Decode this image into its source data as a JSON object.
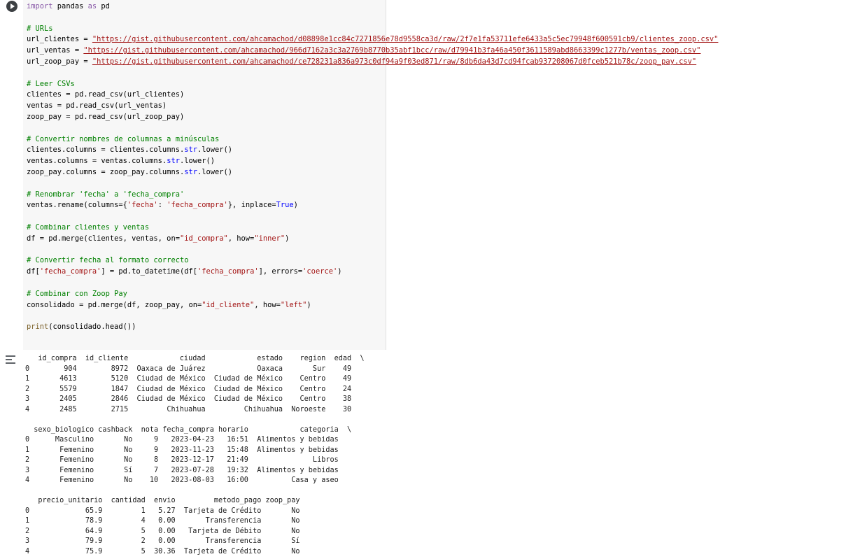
{
  "cell": {
    "code_lines": [
      [
        {
          "t": "import",
          "c": "kw"
        },
        {
          "t": " pandas "
        },
        {
          "t": "as",
          "c": "kw"
        },
        {
          "t": " pd"
        }
      ],
      [],
      [
        {
          "t": "# URLs",
          "c": "cm"
        }
      ],
      [
        {
          "t": "url_clientes = "
        },
        {
          "t": "\"https://gist.githubusercontent.com/ahcamachod/d08898e1cc84c7271856e78d9558ca3d/raw/2f7e1fa53711efe6433a5c5ec79948f600591cb9/clientes_zoop.csv\"",
          "c": "st url"
        }
      ],
      [
        {
          "t": "url_ventas = "
        },
        {
          "t": "\"https://gist.githubusercontent.com/ahcamachod/966d7162a3c3a2769b8770b35abf1bcc/raw/d79941b3fa46a450f3611589abd8663399c1277b/ventas_zoop.csv\"",
          "c": "st url"
        }
      ],
      [
        {
          "t": "url_zoop_pay = "
        },
        {
          "t": "\"https://gist.githubusercontent.com/ahcamachod/ce728231a836a973c0df94a9f03ed871/raw/8db6da43d7cd94fcab937208067d0fceb521b78c/zoop_pay.csv\"",
          "c": "st url"
        }
      ],
      [],
      [
        {
          "t": "# Leer CSVs",
          "c": "cm"
        }
      ],
      [
        {
          "t": "clientes = pd.read_csv(url_clientes)"
        }
      ],
      [
        {
          "t": "ventas = pd.read_csv(url_ventas)"
        }
      ],
      [
        {
          "t": "zoop_pay = pd.read_csv(url_zoop_pay)"
        }
      ],
      [],
      [
        {
          "t": "# Convertir nombres de columnas a minúsculas",
          "c": "cm"
        }
      ],
      [
        {
          "t": "clientes.columns = clientes.columns."
        },
        {
          "t": "str",
          "c": "bi"
        },
        {
          "t": ".lower()"
        }
      ],
      [
        {
          "t": "ventas.columns = ventas.columns."
        },
        {
          "t": "str",
          "c": "bi"
        },
        {
          "t": ".lower()"
        }
      ],
      [
        {
          "t": "zoop_pay.columns = zoop_pay.columns."
        },
        {
          "t": "str",
          "c": "bi"
        },
        {
          "t": ".lower()"
        }
      ],
      [],
      [
        {
          "t": "# Renombrar 'fecha' a 'fecha_compra'",
          "c": "cm"
        }
      ],
      [
        {
          "t": "ventas.rename(columns={"
        },
        {
          "t": "'fecha'",
          "c": "st"
        },
        {
          "t": ": "
        },
        {
          "t": "'fecha_compra'",
          "c": "st"
        },
        {
          "t": "}, inplace="
        },
        {
          "t": "True",
          "c": "bi"
        },
        {
          "t": ")"
        }
      ],
      [],
      [
        {
          "t": "# Combinar clientes y ventas",
          "c": "cm"
        }
      ],
      [
        {
          "t": "df = pd.merge(clientes, ventas, on="
        },
        {
          "t": "\"id_compra\"",
          "c": "st"
        },
        {
          "t": ", how="
        },
        {
          "t": "\"inner\"",
          "c": "st"
        },
        {
          "t": ")"
        }
      ],
      [],
      [
        {
          "t": "# Convertir fecha al formato correcto",
          "c": "cm"
        }
      ],
      [
        {
          "t": "df["
        },
        {
          "t": "'fecha_compra'",
          "c": "st"
        },
        {
          "t": "] = pd.to_datetime(df["
        },
        {
          "t": "'fecha_compra'",
          "c": "st"
        },
        {
          "t": "], errors="
        },
        {
          "t": "'coerce'",
          "c": "st"
        },
        {
          "t": ")"
        }
      ],
      [],
      [
        {
          "t": "# Combinar con Zoop Pay",
          "c": "cm"
        }
      ],
      [
        {
          "t": "consolidado = pd.merge(df, zoop_pay, on="
        },
        {
          "t": "\"id_cliente\"",
          "c": "st"
        },
        {
          "t": ", how="
        },
        {
          "t": "\"left\"",
          "c": "st"
        },
        {
          "t": ")"
        }
      ],
      [],
      [
        {
          "t": "print",
          "c": "fn"
        },
        {
          "t": "(consolidado.head())"
        }
      ]
    ]
  },
  "output": {
    "lines": [
      "   id_compra  id_cliente            ciudad            estado    region  edad  \\",
      "0        904        8972  Oaxaca de Juárez            Oaxaca       Sur    49",
      "1       4613        5120  Ciudad de México  Ciudad de México    Centro    49",
      "2       5579        1847  Ciudad de México  Ciudad de México    Centro    24",
      "3       2405        2846  Ciudad de México  Ciudad de México    Centro    38",
      "4       2485        2715         Chihuahua         Chihuahua  Noroeste    30",
      "",
      "  sexo_biologico cashback  nota fecha_compra horario            categoria  \\",
      "0      Masculino       No     9   2023-04-23   16:51  Alimentos y bebidas",
      "1       Femenino       No     9   2023-11-23   15:48  Alimentos y bebidas",
      "2       Femenino       No     8   2023-12-17   21:49               Libros",
      "3       Femenino       Sí     7   2023-07-28   19:32  Alimentos y bebidas",
      "4       Femenino       No    10   2023-08-03   16:00          Casa y aseo",
      "",
      "   precio_unitario  cantidad  envio         metodo_pago zoop_pay",
      "0             65.9         1   5.27  Tarjeta de Crédito       No",
      "1             78.9         4   0.00       Transferencia       No",
      "2             64.9         5   0.00   Tarjeta de Débito       No",
      "3             79.9         2   0.00       Transferencia       Sí",
      "4             75.9         5  30.36  Tarjeta de Crédito       No"
    ]
  },
  "icons": {
    "run": "play-circle-icon",
    "output": "output-expand-icon"
  }
}
